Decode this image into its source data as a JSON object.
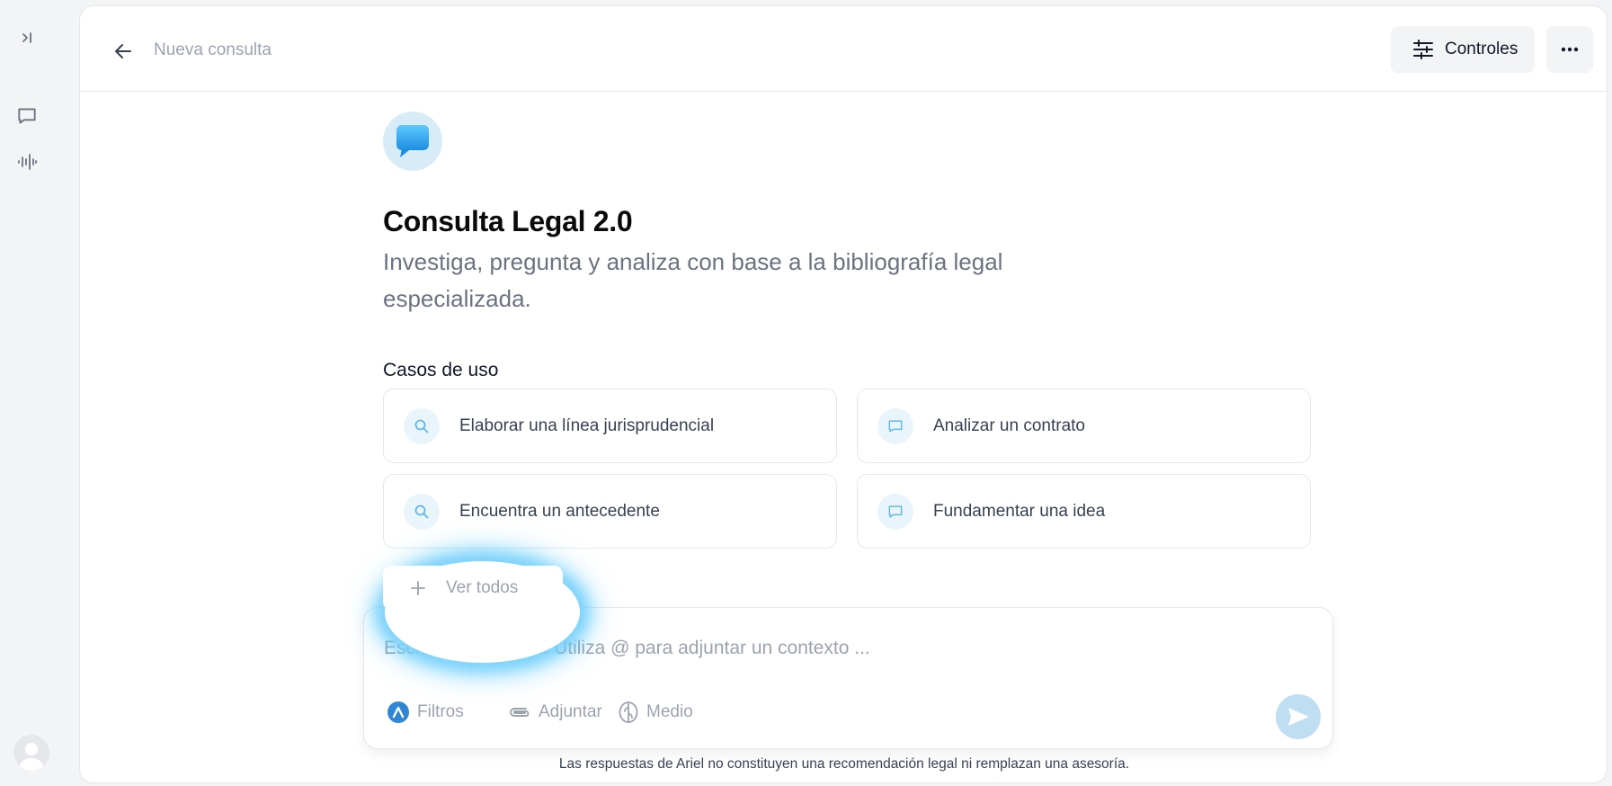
{
  "sidebar": {
    "items": [
      {
        "icon": "expand-sidebar-icon"
      },
      {
        "icon": "chat-bubble-icon"
      },
      {
        "icon": "audio-wave-icon"
      }
    ],
    "avatar": "user-avatar"
  },
  "header": {
    "title": "Nueva consulta",
    "controls_label": "Controles",
    "more_icon": "more-dots-icon"
  },
  "hero": {
    "title": "Consulta Legal 2.0",
    "subtitle": "Investiga, pregunta y analiza con base a la bibliografía legal especializada."
  },
  "use_cases": {
    "label": "Casos de uso",
    "items": [
      {
        "label": "Elaborar una línea jurisprudencial",
        "icon": "search-icon"
      },
      {
        "label": "Analizar un contrato",
        "icon": "chat-bubble-icon"
      },
      {
        "label": "Encuentra un antecedente",
        "icon": "search-icon"
      },
      {
        "label": "Fundamentar una idea",
        "icon": "chat-bubble-icon"
      }
    ],
    "see_all": "Ver todos"
  },
  "composer": {
    "placeholder": "Escribe tu consulta. Utiliza @ para adjuntar un contexto ...",
    "filters_label": "Filtros",
    "attach_label": "Adjuntar",
    "mode_label": "Medio"
  },
  "footer": {
    "disclaimer": "Las respuestas de Ariel no constituyen una recomendación legal ni remplazan una asesoría."
  },
  "colors": {
    "accent": "#38bdf8",
    "icon_bg": "#eaf5fb",
    "send_disabled": "#bfdef2"
  }
}
